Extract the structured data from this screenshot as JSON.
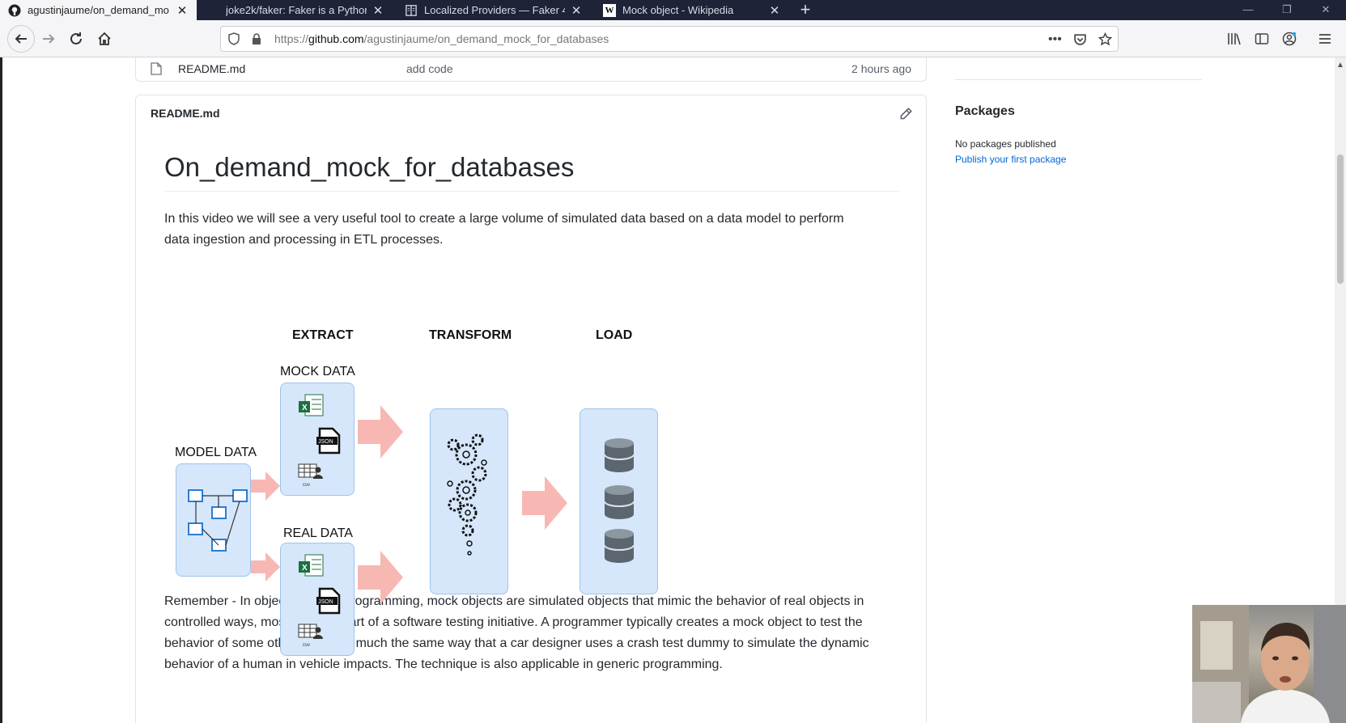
{
  "browser": {
    "tabs": [
      {
        "title": "agustinjaume/on_demand_mo",
        "favicon": "github-icon"
      },
      {
        "title": "joke2k/faker: Faker is a Python",
        "favicon": "blank-icon"
      },
      {
        "title": "Localized Providers — Faker 4.",
        "favicon": "docs-icon"
      },
      {
        "title": "Mock object - Wikipedia",
        "favicon": "wikipedia-icon"
      }
    ],
    "url_prefix": "https://",
    "url_host": "github.com",
    "url_path": "/agustinjaume/on_demand_mock_for_databases"
  },
  "file_row": {
    "name": "README.md",
    "message": "add code",
    "age": "2 hours ago"
  },
  "readme": {
    "header": "README.md",
    "title": "On_demand_mock_for_databases",
    "intro": "In this video we will see a very useful tool to create a large volume of simulated data based on a data model to perform data ingestion and processing in ETL processes.",
    "remember": "Remember - In object-oriented programming, mock objects are simulated objects that mimic the behavior of real objects in controlled ways, most often as part of a software testing initiative. A programmer typically creates a mock object to test the behavior of some other object, in much the same way that a car designer uses a crash test dummy to simulate the dynamic behavior of a human in vehicle impacts. The technique is also applicable in generic programming."
  },
  "diagram": {
    "extract": "EXTRACT",
    "transform": "TRANSFORM",
    "load": "LOAD",
    "mock_data": "MOCK DATA",
    "model_data": "MODEL DATA",
    "real_data": "REAL DATA",
    "json_badge": "JSON",
    "csv_badge": "csv",
    "excel_badge": "X"
  },
  "sidebar": {
    "packages_title": "Packages",
    "no_packages": "No packages published",
    "publish_link": "Publish your first package"
  },
  "colors": {
    "tabbar": "#1f2337",
    "link": "#0366d6",
    "diagram_box": "#d6e7fb",
    "arrow": "#f7b8b3"
  }
}
